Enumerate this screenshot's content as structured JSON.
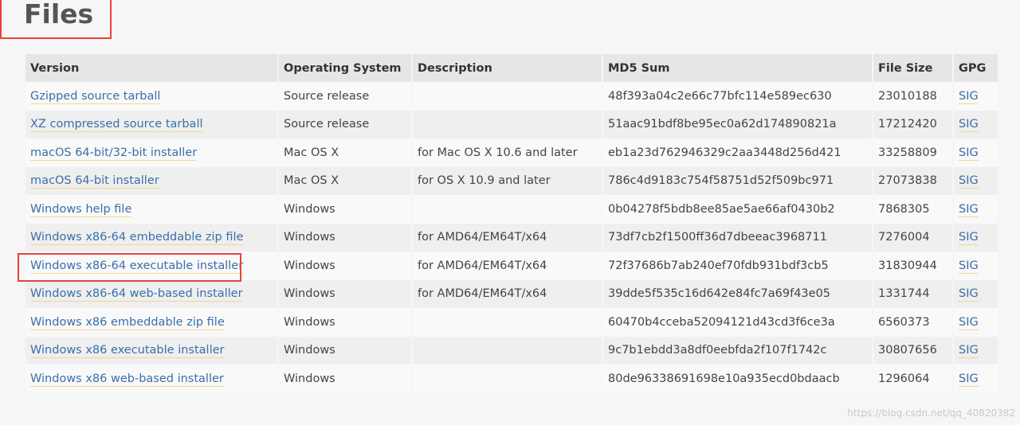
{
  "page": {
    "title": "Files",
    "watermark": "https://blog.csdn.net/qq_40820382"
  },
  "table": {
    "columns": [
      "Version",
      "Operating System",
      "Description",
      "MD5 Sum",
      "File Size",
      "GPG"
    ],
    "rows": [
      {
        "version": "Gzipped source tarball",
        "os": "Source release",
        "description": "",
        "md5": "48f393a04c2e66c77bfc114e589ec630",
        "size": "23010188",
        "gpg": "SIG"
      },
      {
        "version": "XZ compressed source tarball",
        "os": "Source release",
        "description": "",
        "md5": "51aac91bdf8be95ec0a62d174890821a",
        "size": "17212420",
        "gpg": "SIG"
      },
      {
        "version": "macOS 64-bit/32-bit installer",
        "os": "Mac OS X",
        "description": "for Mac OS X 10.6 and later",
        "md5": "eb1a23d762946329c2aa3448d256d421",
        "size": "33258809",
        "gpg": "SIG"
      },
      {
        "version": "macOS 64-bit installer",
        "os": "Mac OS X",
        "description": "for OS X 10.9 and later",
        "md5": "786c4d9183c754f58751d52f509bc971",
        "size": "27073838",
        "gpg": "SIG"
      },
      {
        "version": "Windows help file",
        "os": "Windows",
        "description": "",
        "md5": "0b04278f5bdb8ee85ae5ae66af0430b2",
        "size": "7868305",
        "gpg": "SIG"
      },
      {
        "version": "Windows x86-64 embeddable zip file",
        "os": "Windows",
        "description": "for AMD64/EM64T/x64",
        "md5": "73df7cb2f1500ff36d7dbeeac3968711",
        "size": "7276004",
        "gpg": "SIG"
      },
      {
        "version": "Windows x86-64 executable installer",
        "os": "Windows",
        "description": "for AMD64/EM64T/x64",
        "md5": "72f37686b7ab240ef70fdb931bdf3cb5",
        "size": "31830944",
        "gpg": "SIG"
      },
      {
        "version": "Windows x86-64 web-based installer",
        "os": "Windows",
        "description": "for AMD64/EM64T/x64",
        "md5": "39dde5f535c16d642e84fc7a69f43e05",
        "size": "1331744",
        "gpg": "SIG"
      },
      {
        "version": "Windows x86 embeddable zip file",
        "os": "Windows",
        "description": "",
        "md5": "60470b4cceba52094121d43cd3f6ce3a",
        "size": "6560373",
        "gpg": "SIG"
      },
      {
        "version": "Windows x86 executable installer",
        "os": "Windows",
        "description": "",
        "md5": "9c7b1ebdd3a8df0eebfda2f107f1742c",
        "size": "30807656",
        "gpg": "SIG"
      },
      {
        "version": "Windows x86 web-based installer",
        "os": "Windows",
        "description": "",
        "md5": "80de96338691698e10a935ecd0bdaacb",
        "size": "1296064",
        "gpg": "SIG"
      }
    ]
  },
  "colors": {
    "link": "#3a6fa8",
    "link_underline": "#f2d78b",
    "highlight_box": "#e8413c",
    "header_bg": "#e6e6e6"
  }
}
